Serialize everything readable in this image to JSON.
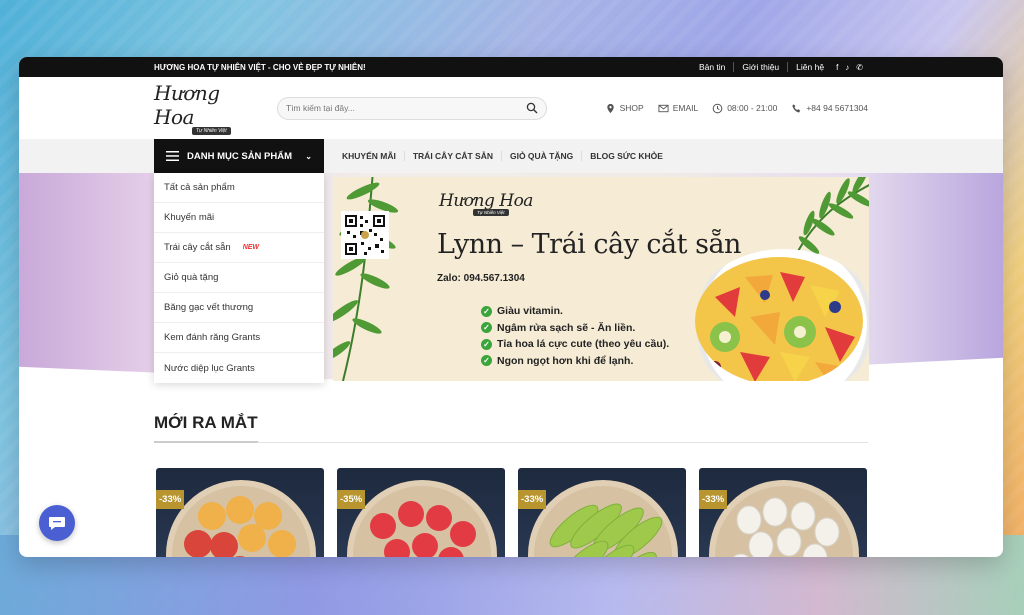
{
  "topbar": {
    "tagline": "HƯƠNG HOA TỰ NHIÊN VIỆT - CHO VẺ ĐẸP TỰ NHIÊN!",
    "links": [
      "Bản tin",
      "Giới thiệu",
      "Liên hệ"
    ],
    "social_icons": [
      "facebook-icon",
      "tiktok-icon",
      "phone-icon"
    ]
  },
  "logo": {
    "main": "Hương Hoa",
    "sub": "Tự Nhiên Việt"
  },
  "search": {
    "placeholder": "Tìm kiếm tại đây..."
  },
  "contacts": {
    "shop": "SHOP",
    "email": "EMAIL",
    "hours": "08:00 - 21:00",
    "phone": "+84 94 5671304"
  },
  "nav": {
    "category_button": "DANH MỤC SẢN PHẨM",
    "items": [
      "KHUYẾN MÃI",
      "TRÁI CÂY CẮT SẴN",
      "GIỎ QUÀ TẶNG",
      "BLOG SỨC KHỎE"
    ]
  },
  "dropdown": {
    "items": [
      {
        "label": "Tất cả sản phẩm"
      },
      {
        "label": "Khuyến mãi"
      },
      {
        "label": "Trái cây cắt sẵn",
        "badge": "NEW"
      },
      {
        "label": "Giỏ quà tặng"
      },
      {
        "label": "Băng gạc vết thương"
      },
      {
        "label": "Kem đánh răng Grants"
      },
      {
        "label": "Nước diệp lục Grants"
      }
    ]
  },
  "banner": {
    "logo_main": "Hương Hoa",
    "logo_sub": "Tự Nhiên Việt",
    "title": "Lynn – Trái cây cắt sẵn",
    "zalo": "Zalo: 094.567.1304",
    "bullets": [
      "Giàu vitamin.",
      "Ngâm rửa sạch sẽ - Ăn liền.",
      "Tỉa hoa lá cực cute (theo yêu cầu).",
      "Ngon ngọt hơn khi để lạnh."
    ]
  },
  "section": {
    "title": "MỚI RA MẮT"
  },
  "products": [
    {
      "discount": "-33%",
      "fruit_color": "#f0b04a",
      "accent": "#d9453a"
    },
    {
      "discount": "-35%",
      "fruit_color": "#e23b44",
      "accent": "#c7283a"
    },
    {
      "discount": "-33%",
      "fruit_color": "#9ec94a",
      "accent": "#7fb03a"
    },
    {
      "discount": "-33%",
      "fruit_color": "#f4f1ea",
      "accent": "#d8d4cc"
    }
  ],
  "colors": {
    "topbar": "#111111",
    "discount": "#b8952e",
    "chat": "#4a5fd1",
    "check": "#3aa53a"
  }
}
